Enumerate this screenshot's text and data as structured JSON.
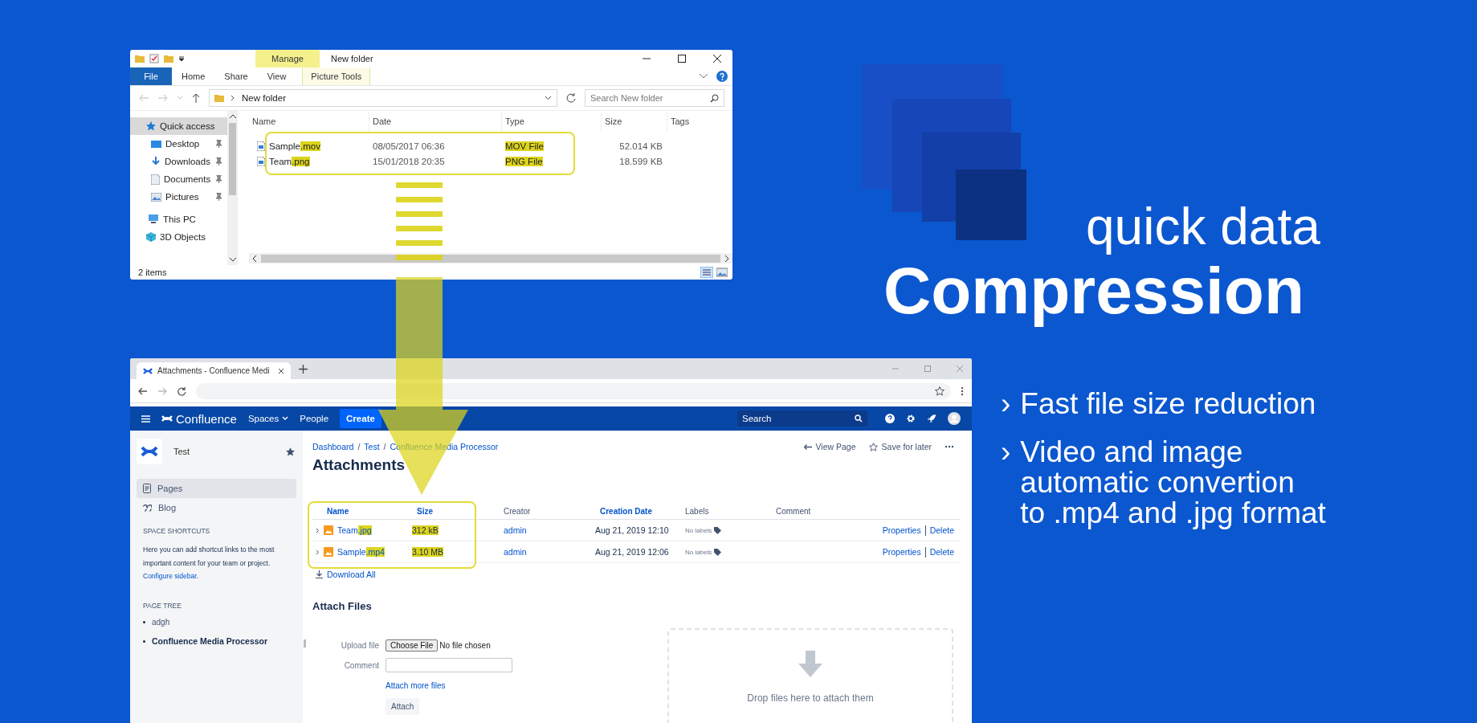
{
  "explorer": {
    "context_tab": "Manage",
    "title": "New folder",
    "tabs": [
      {
        "label": "File",
        "kind": "file"
      },
      {
        "label": "Home",
        "kind": "tab"
      },
      {
        "label": "Share",
        "kind": "tab"
      },
      {
        "label": "View",
        "kind": "tab"
      },
      {
        "label": "Picture Tools",
        "kind": "context"
      }
    ],
    "address": "New folder",
    "search": {
      "placeholder": "Search New folder"
    },
    "nav": [
      {
        "label": "Quick access",
        "selected": true,
        "pinned": false
      },
      {
        "label": "Desktop",
        "selected": false,
        "pinned": true
      },
      {
        "label": "Downloads",
        "selected": false,
        "pinned": true
      },
      {
        "label": "Documents",
        "selected": false,
        "pinned": true
      },
      {
        "label": "Pictures",
        "selected": false,
        "pinned": true
      },
      {
        "label": "This PC",
        "selected": false,
        "pinned": false
      },
      {
        "label": "3D Objects",
        "selected": false,
        "pinned": false
      }
    ],
    "columns": [
      "Name",
      "Date",
      "Type",
      "Size",
      "Tags"
    ],
    "files": [
      {
        "name": "Sample",
        "ext": ".mov",
        "date": "08/05/2017 06:36",
        "type": "MOV File",
        "size": "52.014 KB"
      },
      {
        "name": "Team",
        "ext": ".png",
        "date": "15/01/2018 20:35",
        "type": "PNG File",
        "size": "18.599 KB"
      }
    ],
    "status": "2 items"
  },
  "browser": {
    "tab_title": "Attachments - Confluence Medi",
    "nav": {
      "product": "Confluence",
      "menus": [
        "Spaces",
        "People"
      ],
      "create": "Create",
      "search": {
        "placeholder": "Search"
      }
    },
    "sidebar": {
      "space": "Test",
      "items": [
        {
          "label": "Pages",
          "selected": true
        },
        {
          "label": "Blog",
          "selected": false
        }
      ],
      "shortcuts_heading": "SPACE SHORTCUTS",
      "shortcuts_text": "Here you can add shortcut links to the most important content for your team or project.",
      "configure_link": "Configure sidebar.",
      "tree_heading": "PAGE TREE",
      "tree": [
        {
          "label": "adgh",
          "selected": false
        },
        {
          "label": "Confluence Media Processor",
          "selected": true
        }
      ]
    },
    "breadcrumb": [
      "Dashboard",
      "Test",
      "Confluence Media Processor"
    ],
    "breadcrumb_separator": "/",
    "actions": [
      "View Page",
      "Save for later"
    ],
    "title": "Attachments",
    "columns": [
      {
        "label": "Name",
        "sortable": true
      },
      {
        "label": "Size",
        "sortable": true
      },
      {
        "label": "Creator",
        "sortable": false
      },
      {
        "label": "Creation Date",
        "sortable": true
      },
      {
        "label": "Labels",
        "sortable": false
      },
      {
        "label": "Comment",
        "sortable": false
      }
    ],
    "rows": [
      {
        "name": "Team",
        "ext": ".jpg",
        "size": "312 kB",
        "creator": "admin",
        "date": "Aug 21, 2019 12:10",
        "labels": "No labels",
        "links": [
          "Properties",
          "Delete"
        ]
      },
      {
        "name": "Sample",
        "ext": ".mp4",
        "size": "3.10 MB",
        "creator": "admin",
        "date": "Aug 21, 2019 12:06",
        "labels": "No labels",
        "links": [
          "Properties",
          "Delete"
        ]
      }
    ],
    "download_all": "Download All",
    "attach": {
      "heading": "Attach Files",
      "upload_label": "Upload file",
      "choose_button": "Choose File",
      "no_file": "No file chosen",
      "comment_label": "Comment",
      "more_link": "Attach more files",
      "attach_button": "Attach",
      "drop_text": "Drop files here to attach them"
    }
  },
  "promo": {
    "title_light": "quick data",
    "title_bold": "Compression",
    "bullets": [
      {
        "marker": "›",
        "lines": [
          "Fast file size reduction"
        ]
      },
      {
        "marker": "›",
        "lines": [
          "Video and image",
          "automatic convertion",
          "to .mp4 and .jpg format"
        ]
      }
    ]
  }
}
